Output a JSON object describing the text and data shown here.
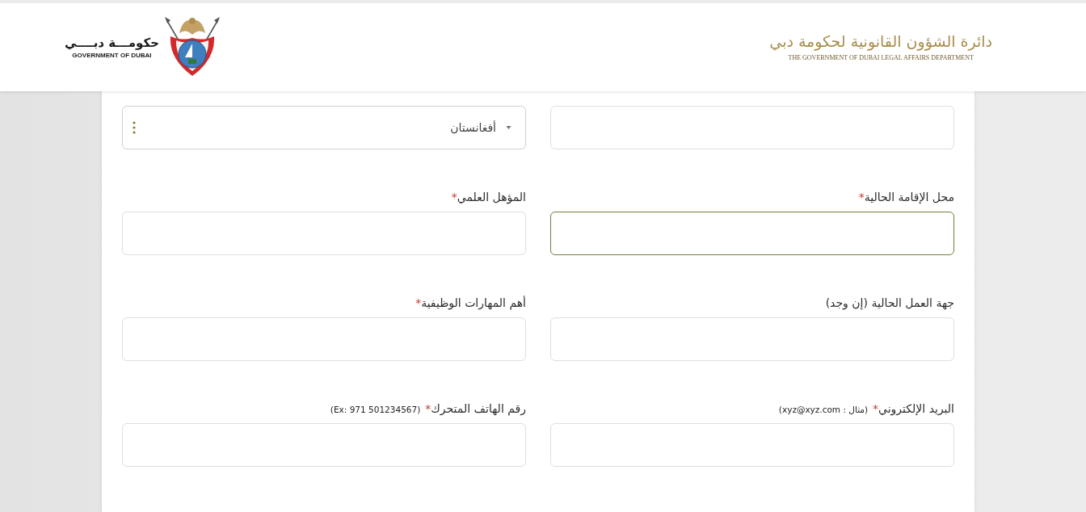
{
  "header": {
    "department_logo": {
      "arabic": "دائرة الشؤون القانونية لحكومة دبي",
      "english": "THE GOVERNMENT OF DUBAI LEGAL AFFAIRS DEPARTMENT"
    },
    "government_logo": {
      "arabic": "حكومـــة دبــــي",
      "english": "GOVERNMENT OF DUBAI"
    }
  },
  "form": {
    "fields": [
      {
        "kind": "text",
        "focused": false
      },
      {
        "kind": "select",
        "value": "أفغانستان",
        "focused": false
      },
      {
        "kind": "text",
        "label": "محل الإقامة الحالية",
        "required_mark": "*",
        "focused": true
      },
      {
        "kind": "text",
        "label": "المؤهل العلمي",
        "required_mark": "*",
        "focused": false
      },
      {
        "kind": "text",
        "label": "جهة العمل الحالية (إن وجد)",
        "focused": false
      },
      {
        "kind": "text",
        "label": "أهم المهارات الوظيفية",
        "required_mark": "*",
        "focused": false
      },
      {
        "kind": "text",
        "label": "البريد الإلكتروني",
        "required_mark": "*",
        "hint": "(مثال : xyz@xyz.com)",
        "focused": false
      },
      {
        "kind": "text",
        "label": "رقم الهاتف المتحرك",
        "required_mark": "*",
        "hint": "(Ex: 971 501234567)",
        "focused": false
      }
    ]
  }
}
